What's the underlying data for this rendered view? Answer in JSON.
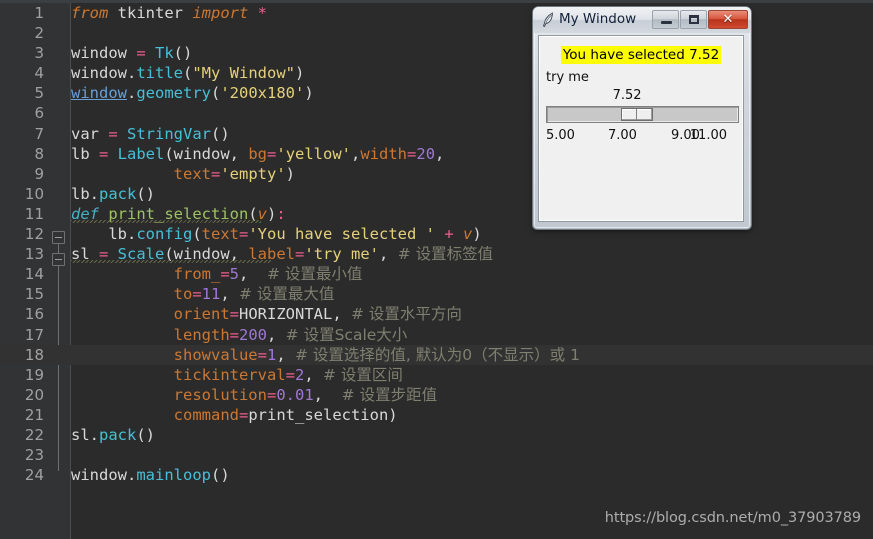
{
  "editor": {
    "watermark": "https://blog.csdn.net/m0_37903789",
    "current_line": 18,
    "theme": {
      "background": "#2b2b2b",
      "gutter_background": "#313335",
      "line_number_color": "#a1a1a1",
      "current_line_background": "#323232",
      "default_text": "#a9b7c6",
      "keyword": "#cc7832",
      "function": "#46c0d8",
      "string": "#e5d17a",
      "number": "#9e78d4",
      "comment": "#7f7f70",
      "operator": "#ed5e8c",
      "function_def": "#9ec362"
    },
    "line_numbers": [
      1,
      2,
      3,
      4,
      5,
      6,
      7,
      8,
      9,
      10,
      11,
      12,
      13,
      14,
      15,
      16,
      17,
      18,
      19,
      20,
      21,
      22,
      23,
      24
    ],
    "code_lines": [
      "from tkinter import *",
      "",
      "window = Tk()",
      "window.title(\"My Window\")",
      "window.geometry('200x180')",
      "",
      "var = StringVar()",
      "lb = Label(window, bg='yellow',width=20,",
      "           text='empty')",
      "lb.pack()",
      "def print_selection(v):",
      "    lb.config(text='You have selected ' + v)",
      "sl = Scale(window, label='try me', # 设置标签值",
      "           from_=5,  # 设置最小值",
      "           to=11, # 设置最大值",
      "           orient=HORIZONTAL, # 设置水平方向",
      "           length=200, # 设置Scale大小",
      "           showvalue=1, # 设置选择的值, 默认为0（不显示）或 1",
      "           tickinterval=2, # 设置区间",
      "           resolution=0.01,  # 设置步距值",
      "           command=print_selection)",
      "sl.pack()",
      "",
      "window.mainloop()"
    ]
  },
  "tk_window": {
    "title": "My Window",
    "icon": "feather-icon",
    "buttons": {
      "minimize": "minimize-button",
      "maximize": "maximize-button",
      "close": "✕"
    },
    "label": {
      "text": "You have selected 7.52",
      "background": "#ffff00",
      "foreground": "#000000"
    },
    "scale": {
      "label": "try me",
      "value": "7.52",
      "value_position_pct": 42,
      "slider_position_pct": 42,
      "from": 5,
      "to": 11,
      "tick_interval": 2,
      "resolution": 0.01,
      "orient": "horizontal",
      "ticks": [
        "5.00",
        "7.00",
        "9.00",
        "11.00"
      ]
    }
  }
}
